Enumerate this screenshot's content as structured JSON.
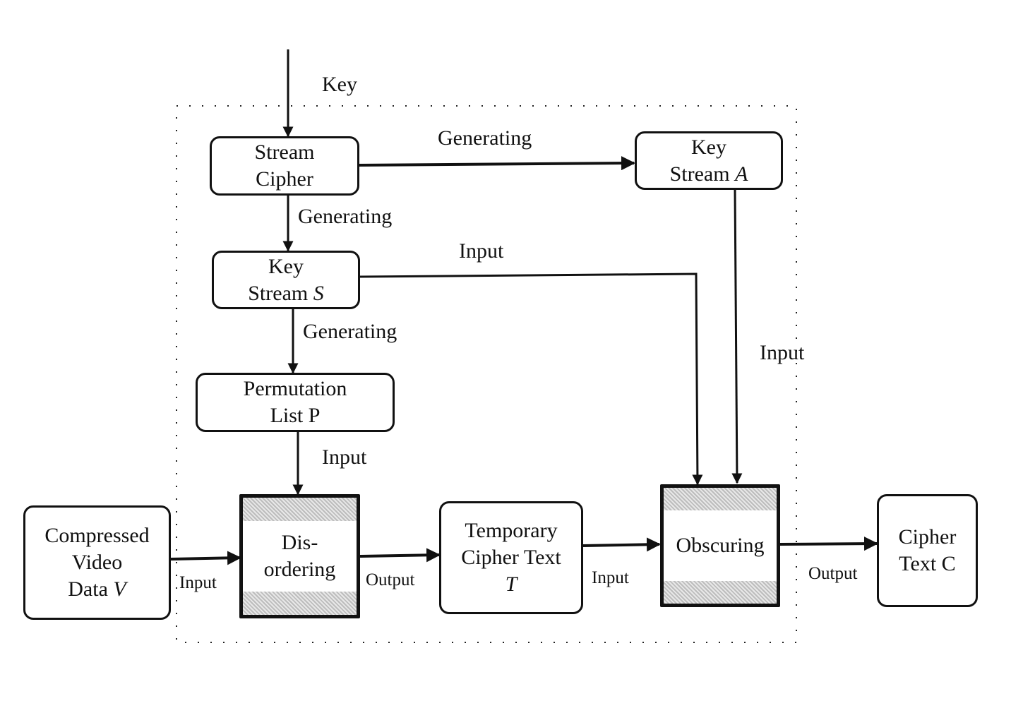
{
  "diagram": {
    "nodes": {
      "stream_cipher": {
        "line1": "Stream",
        "line2": "Cipher"
      },
      "key_stream_a": {
        "line1": "Key",
        "line2_text": "Stream ",
        "line2_var": "A"
      },
      "key_stream_s": {
        "line1": "Key",
        "line2_text": "Stream ",
        "line2_var": "S"
      },
      "permutation_list": {
        "line1": "Permutation",
        "line2": "List P"
      },
      "compressed_video": {
        "line1": "Compressed",
        "line2": "Video",
        "line3_text": "Data ",
        "line3_var": "V"
      },
      "disordering": {
        "line1": "Dis-",
        "line2": "ordering"
      },
      "temporary_cipher": {
        "line1": "Temporary",
        "line2": "Cipher Text",
        "line3_var": "T"
      },
      "obscuring": {
        "line1": "Obscuring"
      },
      "cipher_text": {
        "line1": "Cipher",
        "line2": "Text C"
      }
    },
    "edge_labels": {
      "key": "Key",
      "gen_a": "Generating",
      "gen_s": "Generating",
      "gen_p": "Generating",
      "input_s": "Input",
      "input_a": "Input",
      "input_p": "Input",
      "input_v": "Input",
      "output_dis": "Output",
      "input_t": "Input",
      "output_obs": "Output"
    }
  }
}
